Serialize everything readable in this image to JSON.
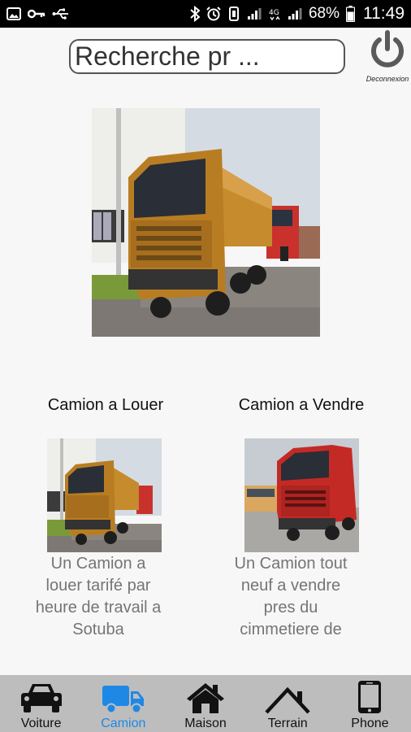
{
  "status_bar": {
    "battery_percent": "68%",
    "time": "11:49",
    "icons_left": [
      "image-icon",
      "key-icon",
      "usb-icon"
    ],
    "icons_right": [
      "bluetooth-icon",
      "alarm-icon",
      "vibrate-icon",
      "signal-icon",
      "4g-icon",
      "signal-icon",
      "battery-icon"
    ]
  },
  "header": {
    "search_placeholder": "Recherche pr ...",
    "logout_label": "Deconnexion"
  },
  "categories": [
    {
      "title": "Camion a Louer",
      "description": "Un Camion a louer tarifé par heure de travail a Sotuba"
    },
    {
      "title": "Camion a Vendre",
      "description": "Un Camion tout neuf a vendre pres du cimmetiere de"
    }
  ],
  "bottom_nav": {
    "items": [
      {
        "label": "Voiture",
        "icon": "car-icon"
      },
      {
        "label": "Camion",
        "icon": "truck-icon",
        "active": true
      },
      {
        "label": "Maison",
        "icon": "house-icon"
      },
      {
        "label": "Terrain",
        "icon": "roof-icon"
      },
      {
        "label": "Phone",
        "icon": "phone-icon"
      }
    ]
  },
  "colors": {
    "status_bar_bg": "#000000",
    "nav_bg": "#bdbdbd",
    "active_accent": "#1e88e5",
    "desc_text": "#757575"
  }
}
